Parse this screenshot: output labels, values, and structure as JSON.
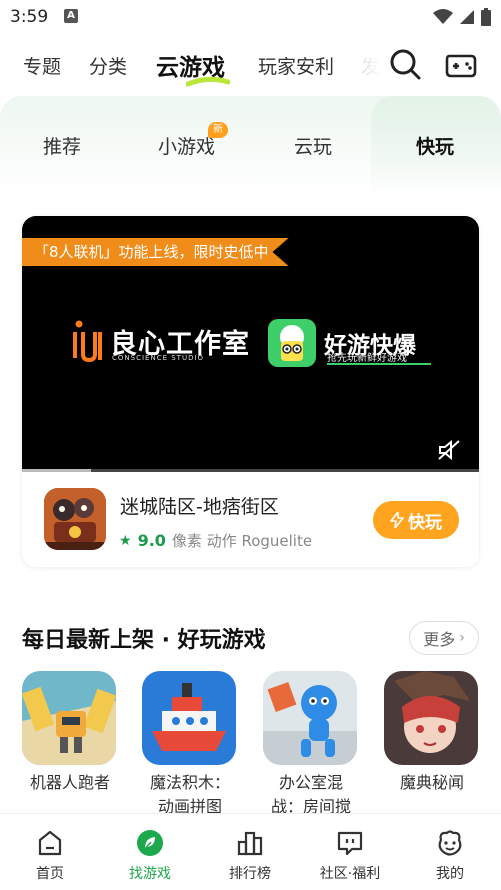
{
  "status": {
    "time": "3:59",
    "app_badge": "A"
  },
  "top_tabs": [
    {
      "label": "专题"
    },
    {
      "label": "分类"
    },
    {
      "label": "云游戏"
    },
    {
      "label": "玩家安利"
    },
    {
      "label": "发"
    }
  ],
  "sub_tabs": [
    {
      "label": "推荐"
    },
    {
      "label": "小游戏",
      "badge": "新"
    },
    {
      "label": "云玩"
    },
    {
      "label": "快玩"
    }
  ],
  "feature": {
    "promo": "「8人联机」功能上线，限时史低中",
    "studio_name": "良心工作室",
    "studio_sub": "CONSCIENCE STUDIO",
    "partner_name": "好游快爆",
    "partner_slogan": "抢先玩新鲜好游戏",
    "progress_fraction": 0.15,
    "game": {
      "title": "迷城陆区-地痞街区",
      "rating": "9.0",
      "tags": "像素 动作 Roguelite",
      "play_label": "快玩"
    }
  },
  "section": {
    "title": "每日最新上架 · 好玩游戏",
    "more_label": "更多",
    "games": [
      {
        "label_line1": "机器人跑者",
        "label_line2": ""
      },
      {
        "label_line1": "魔法积木：",
        "label_line2": "动画拼图"
      },
      {
        "label_line1": "办公室混",
        "label_line2": "战：房间搅"
      },
      {
        "label_line1": "魔典秘闻",
        "label_line2": ""
      }
    ]
  },
  "bottom_nav": [
    {
      "label": "首页"
    },
    {
      "label": "找游戏"
    },
    {
      "label": "排行榜"
    },
    {
      "label": "社区·福利"
    },
    {
      "label": "我的"
    }
  ],
  "colors": {
    "accent_green": "#1ea84d",
    "play_orange": "#ffa41f",
    "promo_orange": "#f08c1a"
  }
}
